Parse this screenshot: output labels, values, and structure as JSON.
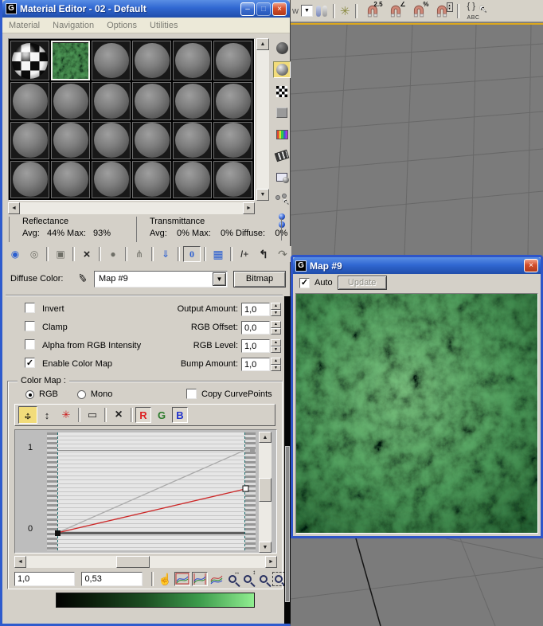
{
  "glyphs": {
    "check": "✓",
    "minimize": "–",
    "maximize": "□",
    "close": "×",
    "dropdown_arrow": "▼",
    "scroll_up": "▲",
    "scroll_down": "▼",
    "scroll_left": "◄",
    "scroll_right": "►",
    "eyedropper": "✎",
    "get_material": "◉",
    "put_material": "◎",
    "assign_material": "▣",
    "reset_map": "×",
    "make_copy": "●",
    "make_unique": "⋔",
    "put_library": "⇓",
    "show_map": "▦",
    "go_parent": "↰",
    "go_sibling": "↷",
    "move_h": "↔",
    "move_v": "↕",
    "scale_point": "↕",
    "add_point": "✳",
    "delete_point": "▭",
    "reset_curves": "×",
    "pan_hand": "☝",
    "angle": "∠",
    "spin_up": "▲",
    "spin_down": "▼",
    "schematic": "✳",
    "cursor": "↖",
    "braces": "{ }"
  },
  "main_toolbar": {
    "partial_label": "w",
    "snap_25": "2.5",
    "percent": "%",
    "abc": "ABC",
    "tools": [
      "selection-dropdown",
      "mirror",
      "schematic-view",
      "snap-toggle-2.5",
      "angle-snap-toggle",
      "percent-snap-toggle",
      "spinner-snap-toggle",
      "named-selection-sets"
    ]
  },
  "material_editor": {
    "title": "Material Editor - 02 - Default",
    "menu_items": [
      "Material",
      "Navigation",
      "Options",
      "Utilities"
    ],
    "side_tools": [
      "sample-type",
      "backlight",
      "background",
      "sample-uv-tiling",
      "video-color-check",
      "make-preview",
      "options",
      "select-by-material",
      "material-map-navigator"
    ],
    "tool_row": [
      "get-material",
      "put-material-to-scene",
      "assign-material-to-selection",
      "reset-map",
      "make-material-copy",
      "make-unique",
      "put-to-library",
      "material-id-channel",
      "show-map-in-viewport",
      "show-end-result",
      "go-to-parent",
      "go-forward-to-sibling"
    ],
    "material_id": "0",
    "show_end_result": "I+",
    "stats": {
      "reflectance_label": "Reflectance",
      "reflectance_values": "Avg:   44% Max:   93%",
      "transmittance_label": "Transmittance",
      "transmittance_values": "Avg:    0% Max:    0% Diffuse:    0%"
    },
    "diffuse_row": {
      "label": "Diffuse Color:",
      "map_name": "Map #9",
      "type_button": "Bitmap"
    },
    "output_params": {
      "checkboxes": [
        {
          "label": "Invert",
          "checked": false
        },
        {
          "label": "Clamp",
          "checked": false
        },
        {
          "label": "Alpha from RGB Intensity",
          "checked": false
        },
        {
          "label": "Enable Color Map",
          "checked": true
        }
      ],
      "spinners": [
        {
          "label": "Output Amount:",
          "value": "1,0"
        },
        {
          "label": "RGB Offset:",
          "value": "0,0"
        },
        {
          "label": "RGB Level:",
          "value": "1,0"
        },
        {
          "label": "Bump Amount:",
          "value": "1,0"
        }
      ]
    },
    "color_map": {
      "group_label": "Color Map :",
      "radios": [
        {
          "label": "RGB",
          "selected": true
        },
        {
          "label": "Mono",
          "selected": false
        }
      ],
      "copy_curvepoints_label": "Copy CurvePoints",
      "channels": [
        "R",
        "G",
        "B"
      ],
      "axis_top": "1",
      "axis_bottom": "0",
      "selected_point_x": "1,0",
      "selected_point_y": "0,53",
      "curves": {
        "red": [
          [
            0,
            0
          ],
          [
            1,
            0.53
          ]
        ],
        "gray": [
          [
            0,
            0
          ],
          [
            1,
            1
          ]
        ]
      },
      "nav_tools": [
        "pan",
        "zoom-horizontal-extents",
        "zoom-value-extents",
        "zoom-extents",
        "zoom-horizontal",
        "zoom-vertical",
        "zoom",
        "zoom-region"
      ]
    }
  },
  "map_window": {
    "title": "Map #9",
    "auto_label": "Auto",
    "auto_checked": true,
    "update_label": "Update"
  },
  "colors": {
    "titlebar_blue": "#2f63cf",
    "viewport_gray": "#7b7b7b",
    "curve_red": "#cc2626",
    "gradient_end_green": "#90ee90",
    "active_viewport_border": "#dca81e"
  }
}
